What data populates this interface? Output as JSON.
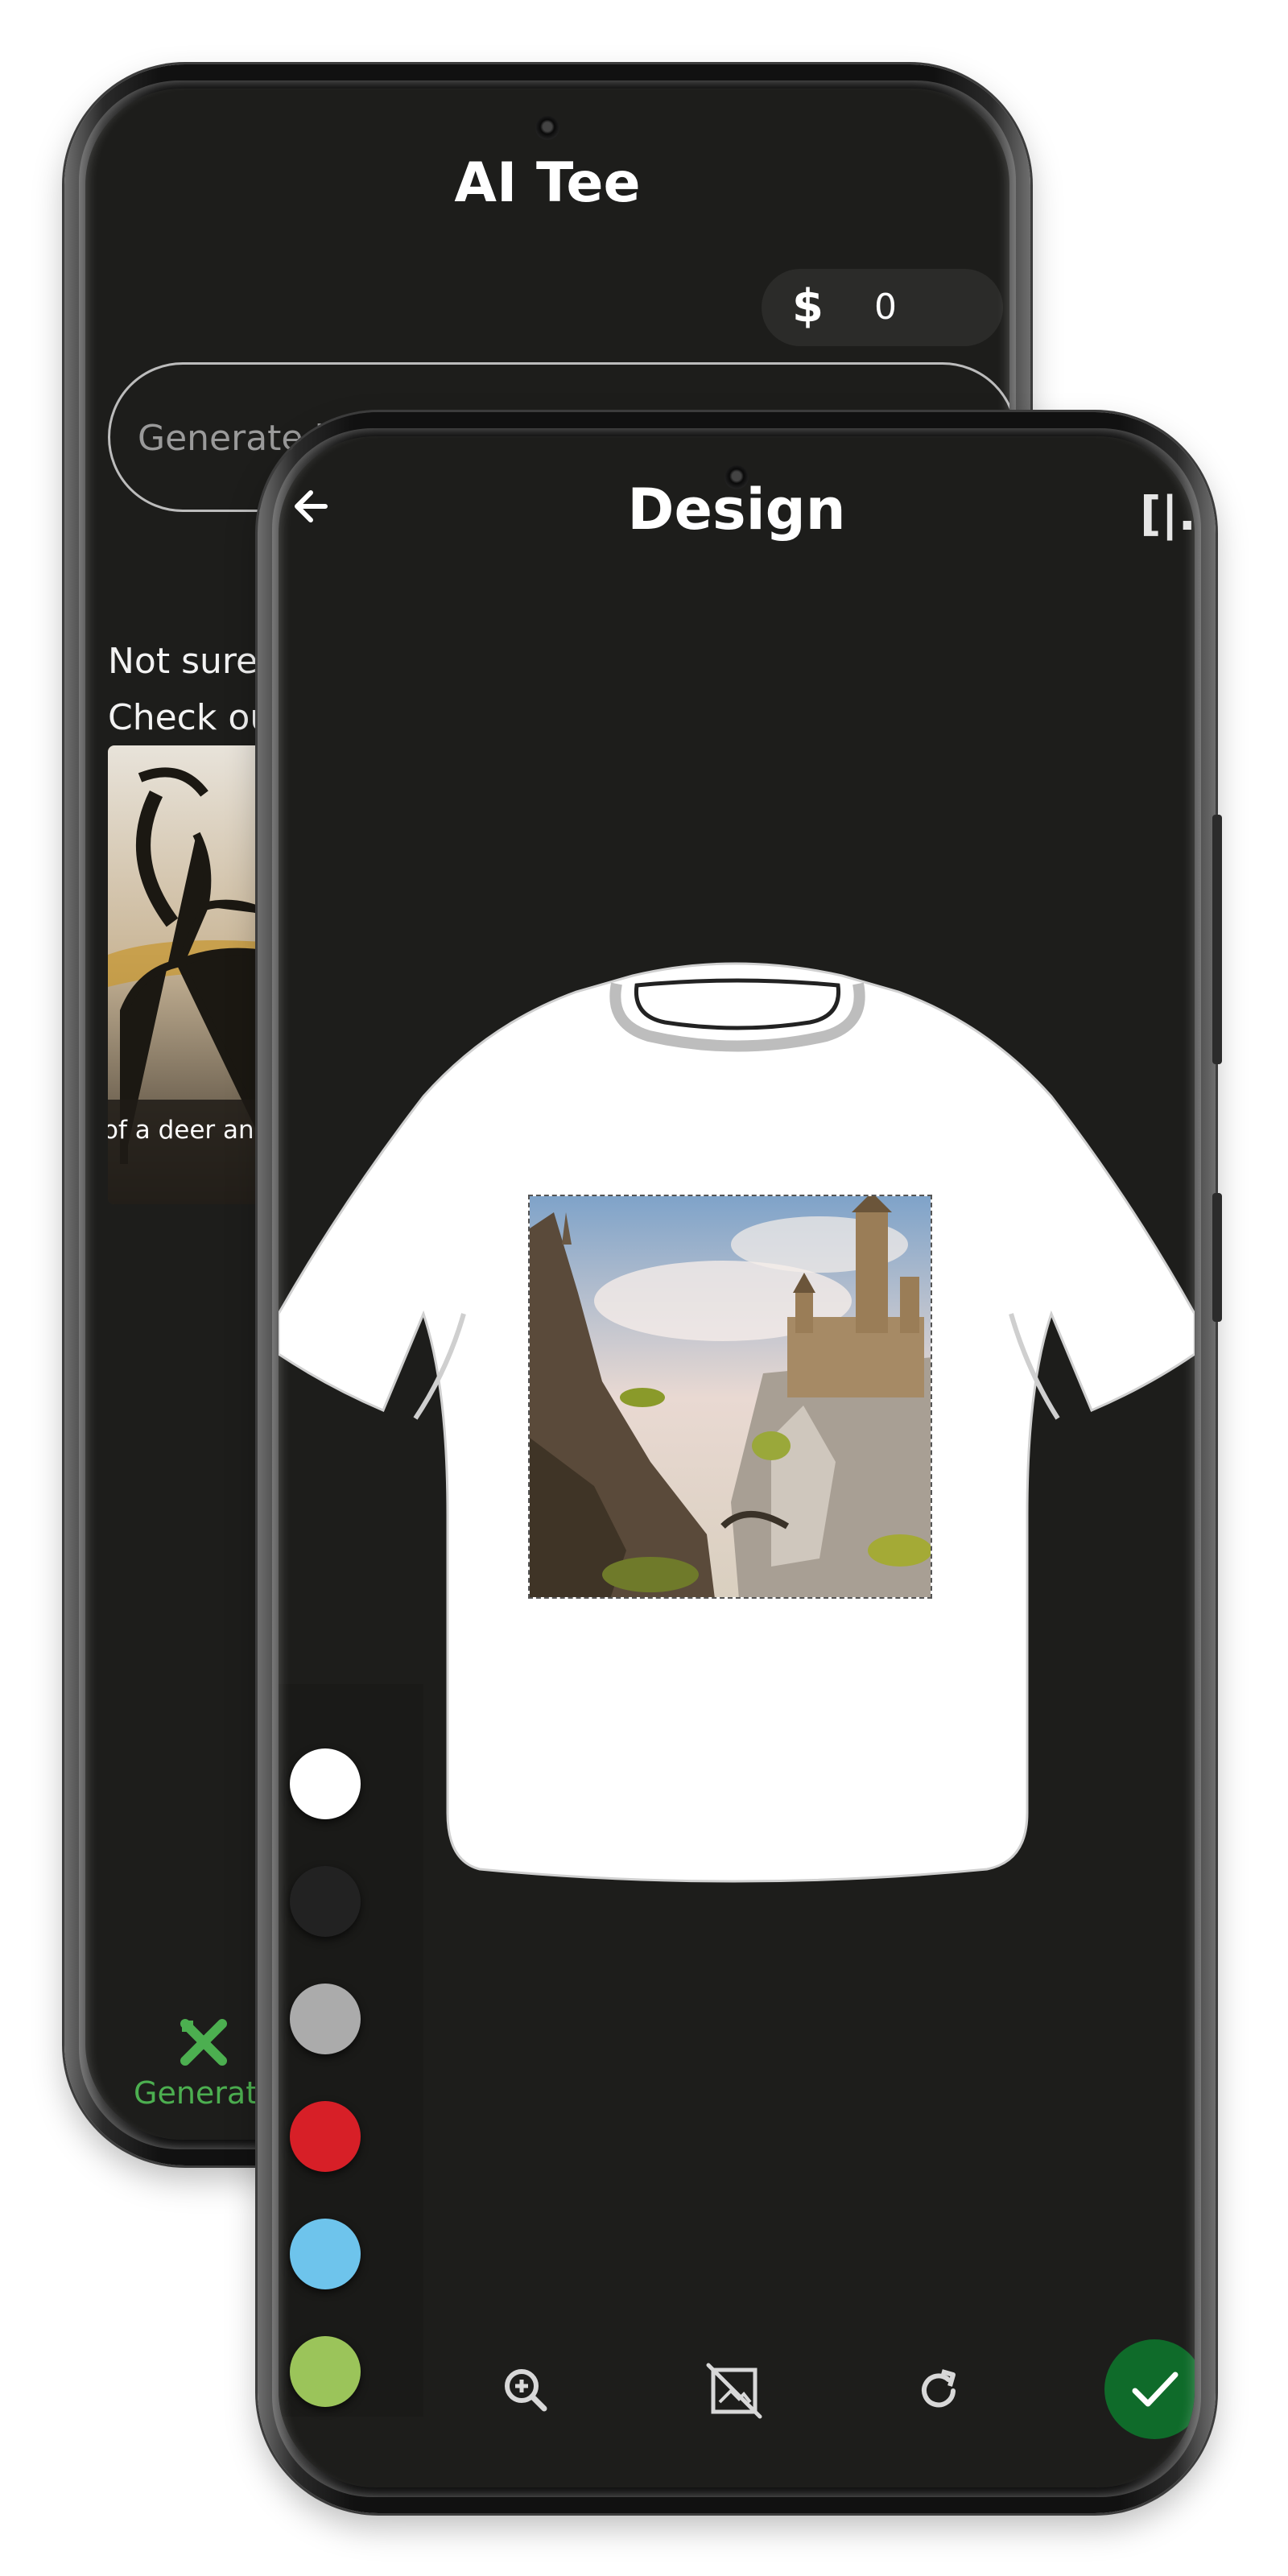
{
  "back_screen": {
    "app_title": "AI Tee",
    "balance": {
      "currency_symbol": "$",
      "amount": "0"
    },
    "prompt_input": {
      "placeholder": "Generate i"
    },
    "hint_lines": [
      "Not sure v",
      "Check out"
    ],
    "example_card": {
      "caption": "of a deer and"
    },
    "bottom_nav": {
      "generate_label": "Generat"
    }
  },
  "front_screen": {
    "title": "Design",
    "top_right_icon_text": "[|.",
    "shirt_color": "#ffffff",
    "color_options": [
      {
        "name": "white",
        "color": "#ffffff"
      },
      {
        "name": "black",
        "color": "#222222"
      },
      {
        "name": "gray",
        "color": "#ababab"
      },
      {
        "name": "red",
        "color": "#d71f27"
      },
      {
        "name": "light-blue",
        "color": "#6ec4ec"
      },
      {
        "name": "green",
        "color": "#9bc45a"
      }
    ],
    "toolbar": [
      "zoom-in",
      "remove-image",
      "rotate",
      "confirm"
    ],
    "accent_color": "#0f6b2a"
  }
}
